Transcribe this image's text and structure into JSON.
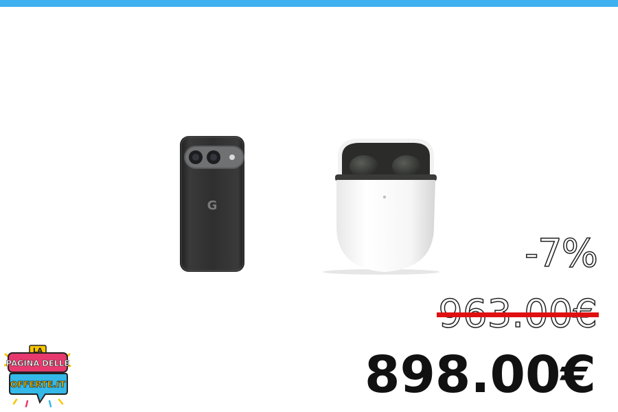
{
  "colors": {
    "top_bar": "#3fb0f0",
    "strike": "#e01010",
    "logo_pink": "#e8396e",
    "logo_cyan": "#33b8e8",
    "logo_yellow": "#f7c600"
  },
  "product": {
    "phone_logo": "G"
  },
  "pricing": {
    "discount": "-7%",
    "old_price": "963.00€",
    "new_price": "898.00€"
  },
  "logo": {
    "line1": "LA",
    "line2": "PAGINA DELLE",
    "line3": "OFFERTE.IT"
  }
}
